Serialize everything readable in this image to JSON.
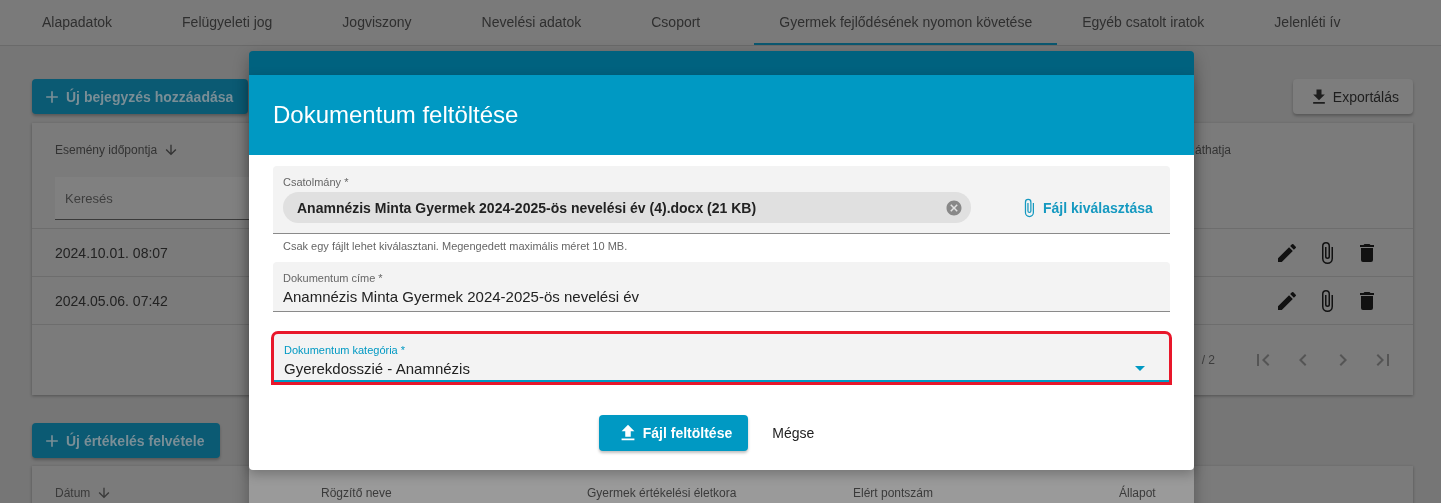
{
  "tabs": [
    {
      "label": "Alapadatok",
      "selected": false
    },
    {
      "label": "Felügyeleti jog",
      "selected": false
    },
    {
      "label": "Jogviszony",
      "selected": false
    },
    {
      "label": "Nevelési adatok",
      "selected": false
    },
    {
      "label": "Csoport",
      "selected": false
    },
    {
      "label": "Gyermek fejlődésének nyomon követése",
      "selected": true
    },
    {
      "label": "Egyéb csatolt iratok",
      "selected": false
    },
    {
      "label": "Jelenléti ív",
      "selected": false
    }
  ],
  "entries": {
    "add_button": "Új bejegyzés hozzáadása",
    "export_button": "Exportálás",
    "columns": [
      {
        "label": "Esemény időpontja",
        "sorted": true
      },
      {
        "label": "áthatja",
        "sorted": false
      }
    ],
    "search_placeholder": "Keresés",
    "rows": [
      {
        "date": "2024.10.01. 08:07"
      },
      {
        "date": "2024.05.06. 07:42"
      }
    ],
    "paginator": "/ 2"
  },
  "evaluations": {
    "add_button": "Új értékelés felvétele",
    "columns": [
      {
        "label": "Dátum",
        "sorted": true
      },
      {
        "label": "Rögzítő neve",
        "sorted": false
      },
      {
        "label": "Gyermek értékelési életkora",
        "sorted": false
      },
      {
        "label": "Elért pontszám",
        "sorted": false
      },
      {
        "label": "Állapot",
        "sorted": false
      }
    ]
  },
  "dialog": {
    "title": "Dokumentum feltöltése",
    "attachment": {
      "label": "Csatolmány *",
      "file": "Anamnézis Minta Gyermek 2024-2025-ös nevelési év (4).docx (21 KB)",
      "choose_button": "Fájl kiválasztása",
      "hint": "Csak egy fájlt lehet kiválasztani. Megengedett maximális méret 10 MB."
    },
    "fields": [
      {
        "kind": "text",
        "label": "Dokumentum címe *",
        "value": "Anamnézis Minta Gyermek 2024-2025-ös nevelési év",
        "focused": false,
        "highlighted": false
      },
      {
        "kind": "dropdown",
        "label": "Dokumentum kategória *",
        "value": "Gyerekdosszié - Anamnézis",
        "focused": true,
        "highlighted": true
      }
    ],
    "buttons": [
      {
        "kind": "primary",
        "label": "Fájl feltöltése"
      },
      {
        "kind": "text",
        "label": "Mégse"
      }
    ]
  }
}
